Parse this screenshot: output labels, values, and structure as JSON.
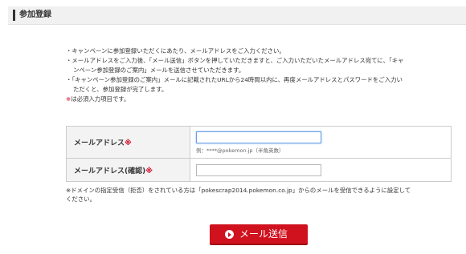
{
  "header": {
    "title": "参加登録"
  },
  "notes": {
    "line1": "・キャンペーンに参加登録いただくにあたり、メールアドレスをご入力ください。",
    "line2": "・メールアドレスをご入力後、「メール送信」ボタンを押していただきますと、ご入力いただいたメールアドレス宛てに、「キャ",
    "line3": "ンペーン参加登録のご案内」メールを送信させていただきます。",
    "line4": "・「キャンペーン参加登録のご案内」メールに記載されたURLから24時間以内に、再度メールアドレスとパスワードをご入力い",
    "line5": "ただくと、参加登録が完了します。",
    "required_mark": "※",
    "required_text": "は必須入力項目です。"
  },
  "form": {
    "email": {
      "label": "メールアドレス",
      "required_mark": "※",
      "value": "",
      "hint": "例：****@pokemon.jp（半角英数）"
    },
    "email_confirm": {
      "label": "メールアドレス(確認)",
      "required_mark": "※",
      "value": ""
    }
  },
  "footnote": {
    "line1": "※ドメインの指定受信（拒否）をされている方は「pokescrap2014.pokemon.co.jp」からのメールを受信できるように設定して",
    "line2": "ください。"
  },
  "send_button": {
    "label": "メール送信",
    "icon": "play-circle-icon"
  },
  "colors": {
    "accent": "#d0111e",
    "required": "#d0001c",
    "header_bg": "#f1f1f1"
  }
}
